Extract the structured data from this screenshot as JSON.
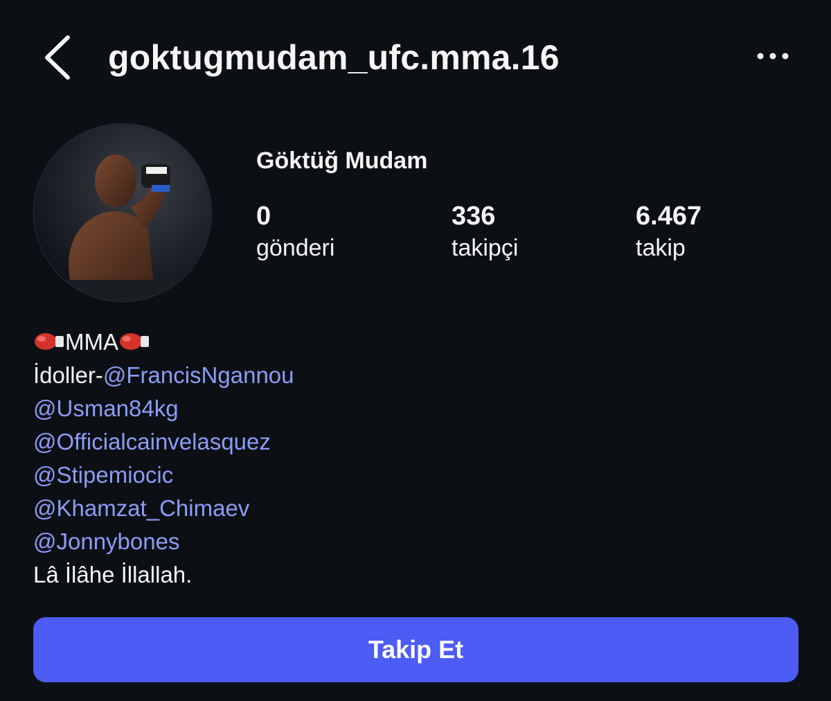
{
  "header": {
    "username": "goktugmudam_ufc.mma.16"
  },
  "profile": {
    "display_name": "Göktüğ Mudam",
    "stats": [
      {
        "value": "0",
        "label": "gönderi"
      },
      {
        "value": "336",
        "label": "takipçi"
      },
      {
        "value": "6.467",
        "label": "takip"
      }
    ]
  },
  "bio": {
    "line1_text": "MMA",
    "idols_prefix": "İdoller-",
    "mentions": [
      "@FrancisNgannou",
      "@Usman84kg",
      "@Officialcainvelasquez",
      "@Stipemiocic",
      "@Khamzat_Chimaev",
      "@Jonnybones"
    ],
    "last_line": "Lâ İlâhe İllallah."
  },
  "actions": {
    "follow_label": "Takip Et"
  },
  "colors": {
    "background": "#0c1014",
    "mention": "#8c9cf7",
    "follow_button": "#4c5cf5"
  }
}
